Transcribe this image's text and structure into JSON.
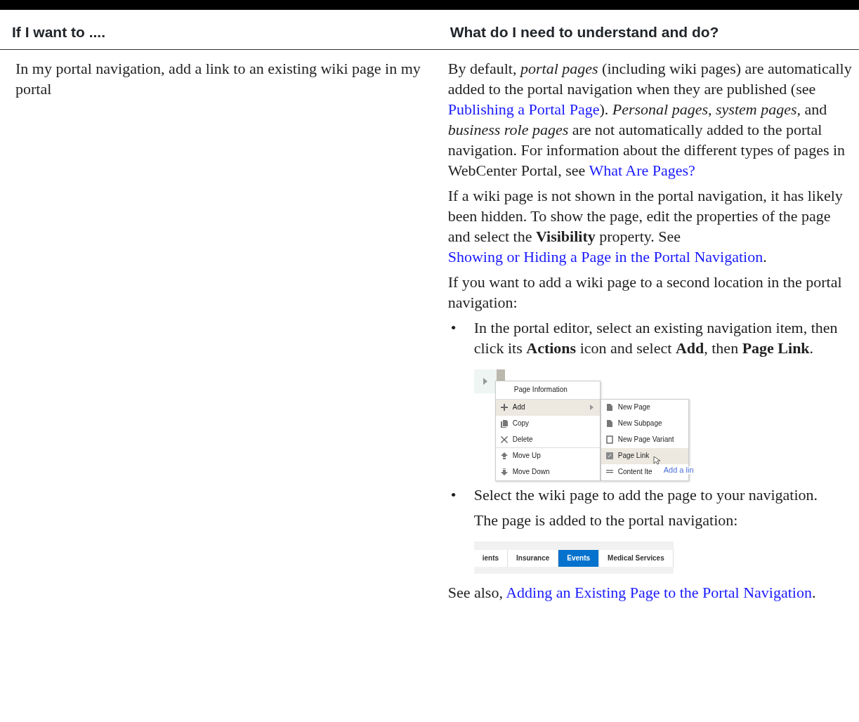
{
  "table": {
    "columns": [
      "If I want to ....",
      "What do I need to understand and do?"
    ],
    "rows": [
      {
        "task": "In my portal navigation, add a link to an existing wiki page in my portal",
        "answer": [
          {
            "kind": "paragraph",
            "parts": [
              {
                "kind": "text",
                "text": "By default, *portal pages* (including wiki pages) are automatically added to the portal navigation when they are published (see "
              },
              {
                "kind": "link",
                "text": "Publishing a Portal Page"
              },
              {
                "kind": "text",
                "text": "). *Personal pages*, *system pages*, and *business role pages* are not automatically added to the portal navigation. For information about the different types of pages in WebCenter Portal, see "
              },
              {
                "kind": "link",
                "text": "What Are Pages?"
              }
            ]
          },
          {
            "kind": "paragraph",
            "parts": [
              {
                "kind": "text",
                "text": "If a wiki page is not shown in the portal navigation, it has likely been hidden. To show the page, edit the properties of the page and select the **Visibility** property. See "
              },
              {
                "kind": "link",
                "text": "Showing or Hiding a Page in the Portal Navigation"
              },
              {
                "kind": "text",
                "text": "."
              }
            ]
          },
          {
            "kind": "paragraph",
            "parts": [
              {
                "kind": "text",
                "text": "If you want to add a wiki page to a second location in the portal navigation:"
              }
            ]
          },
          {
            "kind": "bullet",
            "bullet": "•",
            "parts": [
              {
                "kind": "text",
                "text": "In the portal editor, select an existing navigation item, then click its **Actions** icon and select **Add**, then **Page Link**."
              }
            ]
          },
          {
            "kind": "menu_screenshot",
            "menu": [
              {
                "label": "Page Information",
                "selected": false
              },
              {
                "label": "Add",
                "selected": true
              },
              {
                "label": "Copy",
                "selected": false
              },
              {
                "label": "Delete",
                "selected": false
              },
              {
                "label": "Move Up",
                "selected": false
              },
              {
                "label": "Move Down",
                "selected": false
              }
            ],
            "submenu": [
              {
                "label": "New Page",
                "selected": false
              },
              {
                "label": "New Subpage",
                "selected": false
              },
              {
                "label": "New Page Variant",
                "selected": false
              },
              {
                "label": "Page Link",
                "selected": true
              },
              {
                "label": "Content Ite",
                "selected": false
              }
            ],
            "tooltip": "Add a lin"
          },
          {
            "kind": "bullet",
            "bullet": "•",
            "parts": [
              {
                "kind": "text",
                "text": "Select the wiki page to add the page to your navigation."
              }
            ]
          },
          {
            "kind": "subparagraph",
            "parts": [
              {
                "kind": "text",
                "text": "The page is added to the portal navigation:"
              }
            ]
          },
          {
            "kind": "tabs_screenshot",
            "tabs": [
              {
                "label": "ients",
                "selected": false
              },
              {
                "label": "Insurance",
                "selected": false
              },
              {
                "label": "Events",
                "selected": true
              },
              {
                "label": "Medical Services",
                "selected": false
              }
            ]
          },
          {
            "kind": "paragraph",
            "parts": [
              {
                "kind": "text",
                "text": "See also, "
              },
              {
                "kind": "link",
                "text": "Adding an Existing Page to the Portal Navigation"
              },
              {
                "kind": "text",
                "text": "."
              }
            ]
          }
        ]
      }
    ]
  }
}
